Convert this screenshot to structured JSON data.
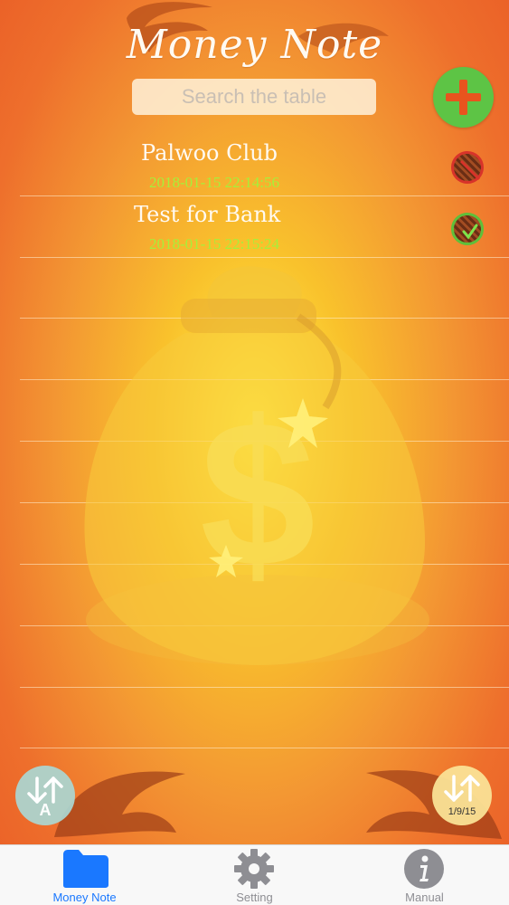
{
  "app": {
    "title": "Money Note"
  },
  "search": {
    "placeholder": "Search the table"
  },
  "toolbar": {
    "add_icon": "plus-icon"
  },
  "notes": [
    {
      "name": "Palwoo Club",
      "date": "2018-01-15 22:14:56",
      "status": "off"
    },
    {
      "name": "Test for Bank",
      "date": "2018-01-15 22:15:24",
      "status": "on"
    }
  ],
  "sort_buttons": {
    "alpha_letter": "A",
    "date_text": "1/9/15"
  },
  "tabbar": {
    "tabs": [
      {
        "label": "Money Note",
        "icon": "folder-icon",
        "active": true
      },
      {
        "label": "Setting",
        "icon": "gear-icon",
        "active": false
      },
      {
        "label": "Manual",
        "icon": "info-icon",
        "active": false
      }
    ]
  },
  "colors": {
    "accent": "#1a78ff",
    "add_button": "#5dc445",
    "date_text": "#a7ef3a",
    "background_center": "#fff24a",
    "background_edge": "#ea5f27"
  }
}
